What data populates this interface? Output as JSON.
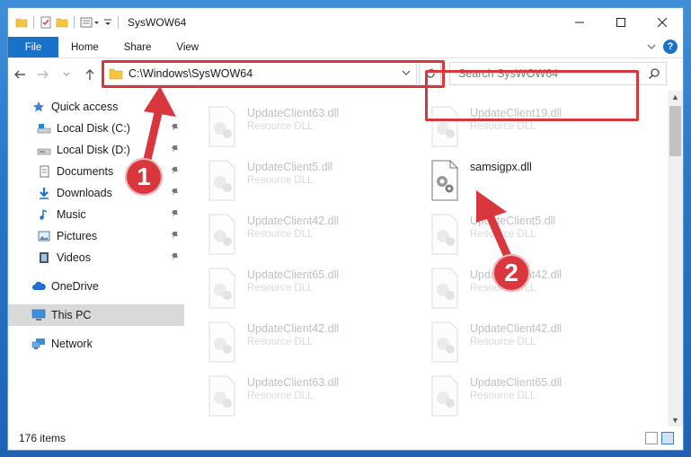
{
  "window": {
    "title": "SysWOW64"
  },
  "ribbon": {
    "tabs": [
      "File",
      "Home",
      "Share",
      "View"
    ],
    "help": "?"
  },
  "navbar": {
    "path": "C:\\Windows\\SysWOW64",
    "search_placeholder": "Search SysWOW64"
  },
  "sidebar": {
    "items": [
      {
        "label": "Quick access",
        "icon": "star-icon"
      },
      {
        "label": "Local Disk (C:)",
        "icon": "drive-icon"
      },
      {
        "label": "Local Disk (D:)",
        "icon": "drive-icon"
      },
      {
        "label": "Documents",
        "icon": "documents-icon"
      },
      {
        "label": "Downloads",
        "icon": "download-icon"
      },
      {
        "label": "Music",
        "icon": "music-icon"
      },
      {
        "label": "Pictures",
        "icon": "pictures-icon"
      },
      {
        "label": "Videos",
        "icon": "videos-icon"
      },
      {
        "label": "OneDrive",
        "icon": "cloud-icon"
      },
      {
        "label": "This PC",
        "icon": "pc-icon"
      },
      {
        "label": "Network",
        "icon": "network-icon"
      }
    ]
  },
  "files": [
    {
      "name": "UpdateClient63.dll",
      "type": "Resource DLL"
    },
    {
      "name": "UpdateClient19.dll",
      "type": "Resource DLL"
    },
    {
      "name": "UpdateClient5.dll",
      "type": "Resource DLL"
    },
    {
      "name": "samsigpx.dll",
      "type": ""
    },
    {
      "name": "UpdateClient42.dll",
      "type": "Resource DLL"
    },
    {
      "name": "UpdateClient5.dll",
      "type": "Resource DLL"
    },
    {
      "name": "UpdateClient65.dll",
      "type": "Resource DLL"
    },
    {
      "name": "UpdateClient42.dll",
      "type": "Resource DLL"
    },
    {
      "name": "UpdateClient42.dll",
      "type": "Resource DLL"
    },
    {
      "name": "UpdateClient42.dll",
      "type": "Resource DLL"
    },
    {
      "name": "UpdateClient63.dll",
      "type": "Resource DLL"
    },
    {
      "name": "UpdateClient65.dll",
      "type": "Resource DLL"
    }
  ],
  "status": {
    "items": "176 items"
  },
  "annotations": {
    "step1": "1",
    "step2": "2"
  },
  "colors": {
    "accent": "#1a72c8",
    "annotation": "#d9363e"
  }
}
